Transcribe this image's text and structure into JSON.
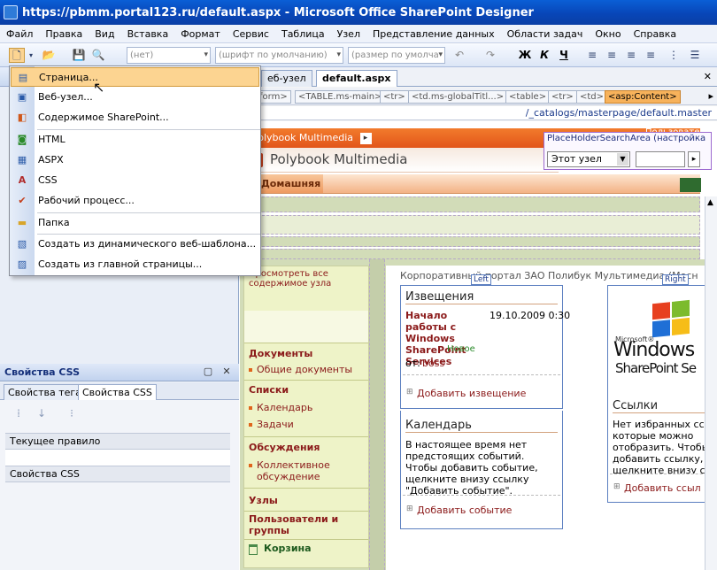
{
  "window": {
    "title": "https://pbmm.portal123.ru/default.aspx - Microsoft Office SharePoint Designer"
  },
  "menu": [
    "Файл",
    "Правка",
    "Вид",
    "Вставка",
    "Формат",
    "Сервис",
    "Таблица",
    "Узел",
    "Представление данных",
    "Области задач",
    "Окно",
    "Справка"
  ],
  "toolbar": {
    "style_value": "(нет)",
    "font_value": "(шрифт по умолчанию)",
    "size_value": "(размер по умолча",
    "bold": "Ж",
    "italic": "К",
    "underline": "Ч"
  },
  "new_menu": {
    "items": [
      "Страница...",
      "Веб-узел...",
      "Содержимое SharePoint...",
      "HTML",
      "ASPX",
      "CSS",
      "Рабочий процесс...",
      "Папка",
      "Создать из динамического веб-шаблона...",
      "Создать из главной страницы..."
    ]
  },
  "css_panel": {
    "title": "Свойства CSS",
    "tabs": [
      "Свойства тега",
      "Свойства CSS"
    ],
    "current_rule_label": "Текущее правило",
    "css_properties_label": "Свойства CSS"
  },
  "doc_tabs": [
    "еб-узел",
    "default.aspx"
  ],
  "tag_selector": [
    "form>",
    "<TABLE.ms-main>",
    "<tr>",
    "<td.ms-globalTitl...>",
    "<table>",
    "<tr>",
    "<td>",
    "<asp:Content>"
  ],
  "master_path": "/_catalogs/masterpage/default.master",
  "page": {
    "top_link": "Polybook Multimedia",
    "site_title": "Polybook Multimedia",
    "top_right_text": "Пользовате",
    "search_placeholder_label": "PlaceHolderSearchArea (настройка",
    "search_scope": "Этот узел",
    "home_tab": "Домашняя",
    "nav_view_all": "Просмотреть все содержимое узла",
    "nav_sections": [
      {
        "title": "Документы",
        "items": [
          "Общие документы"
        ]
      },
      {
        "title": "Списки",
        "items": [
          "Календарь",
          "Задачи"
        ]
      },
      {
        "title": "Обсуждения",
        "items": [
          "Коллективное обсуждение"
        ]
      },
      {
        "title": "Узлы",
        "items": []
      },
      {
        "title": "Пользователи и группы",
        "items": []
      }
    ],
    "recycle": "Корзина",
    "portal_caption": "Корпоративный портал ЗАО Полибук Мультимедиа (Мосн",
    "zone_left": "Left",
    "zone_right": "Right",
    "announcements": {
      "title": "Извещения",
      "item_title": "Начало работы с Windows SharePoint Services",
      "new_badge": "Новое",
      "date": "19.10.2009 0:30",
      "from_label": "от:",
      "from_user": "boss",
      "add": "Добавить извещение"
    },
    "calendar": {
      "title": "Календарь",
      "text": "В настоящее время нет предстоящих событий. Чтобы добавить событие, щелкните внизу ссылку \"Добавить событие\".",
      "add": "Добавить событие"
    },
    "links": {
      "title": "Ссылки",
      "text": "Нет избранных ссы которые можно отобразить. Чтобы добавить ссылку, щелкните внизу сс \"Добавить ссылку\"",
      "add": "Добавить ссыл"
    },
    "ms_logo": {
      "small": "Microsoft®",
      "big": "Windows",
      "product": "SharePoint Se"
    }
  }
}
